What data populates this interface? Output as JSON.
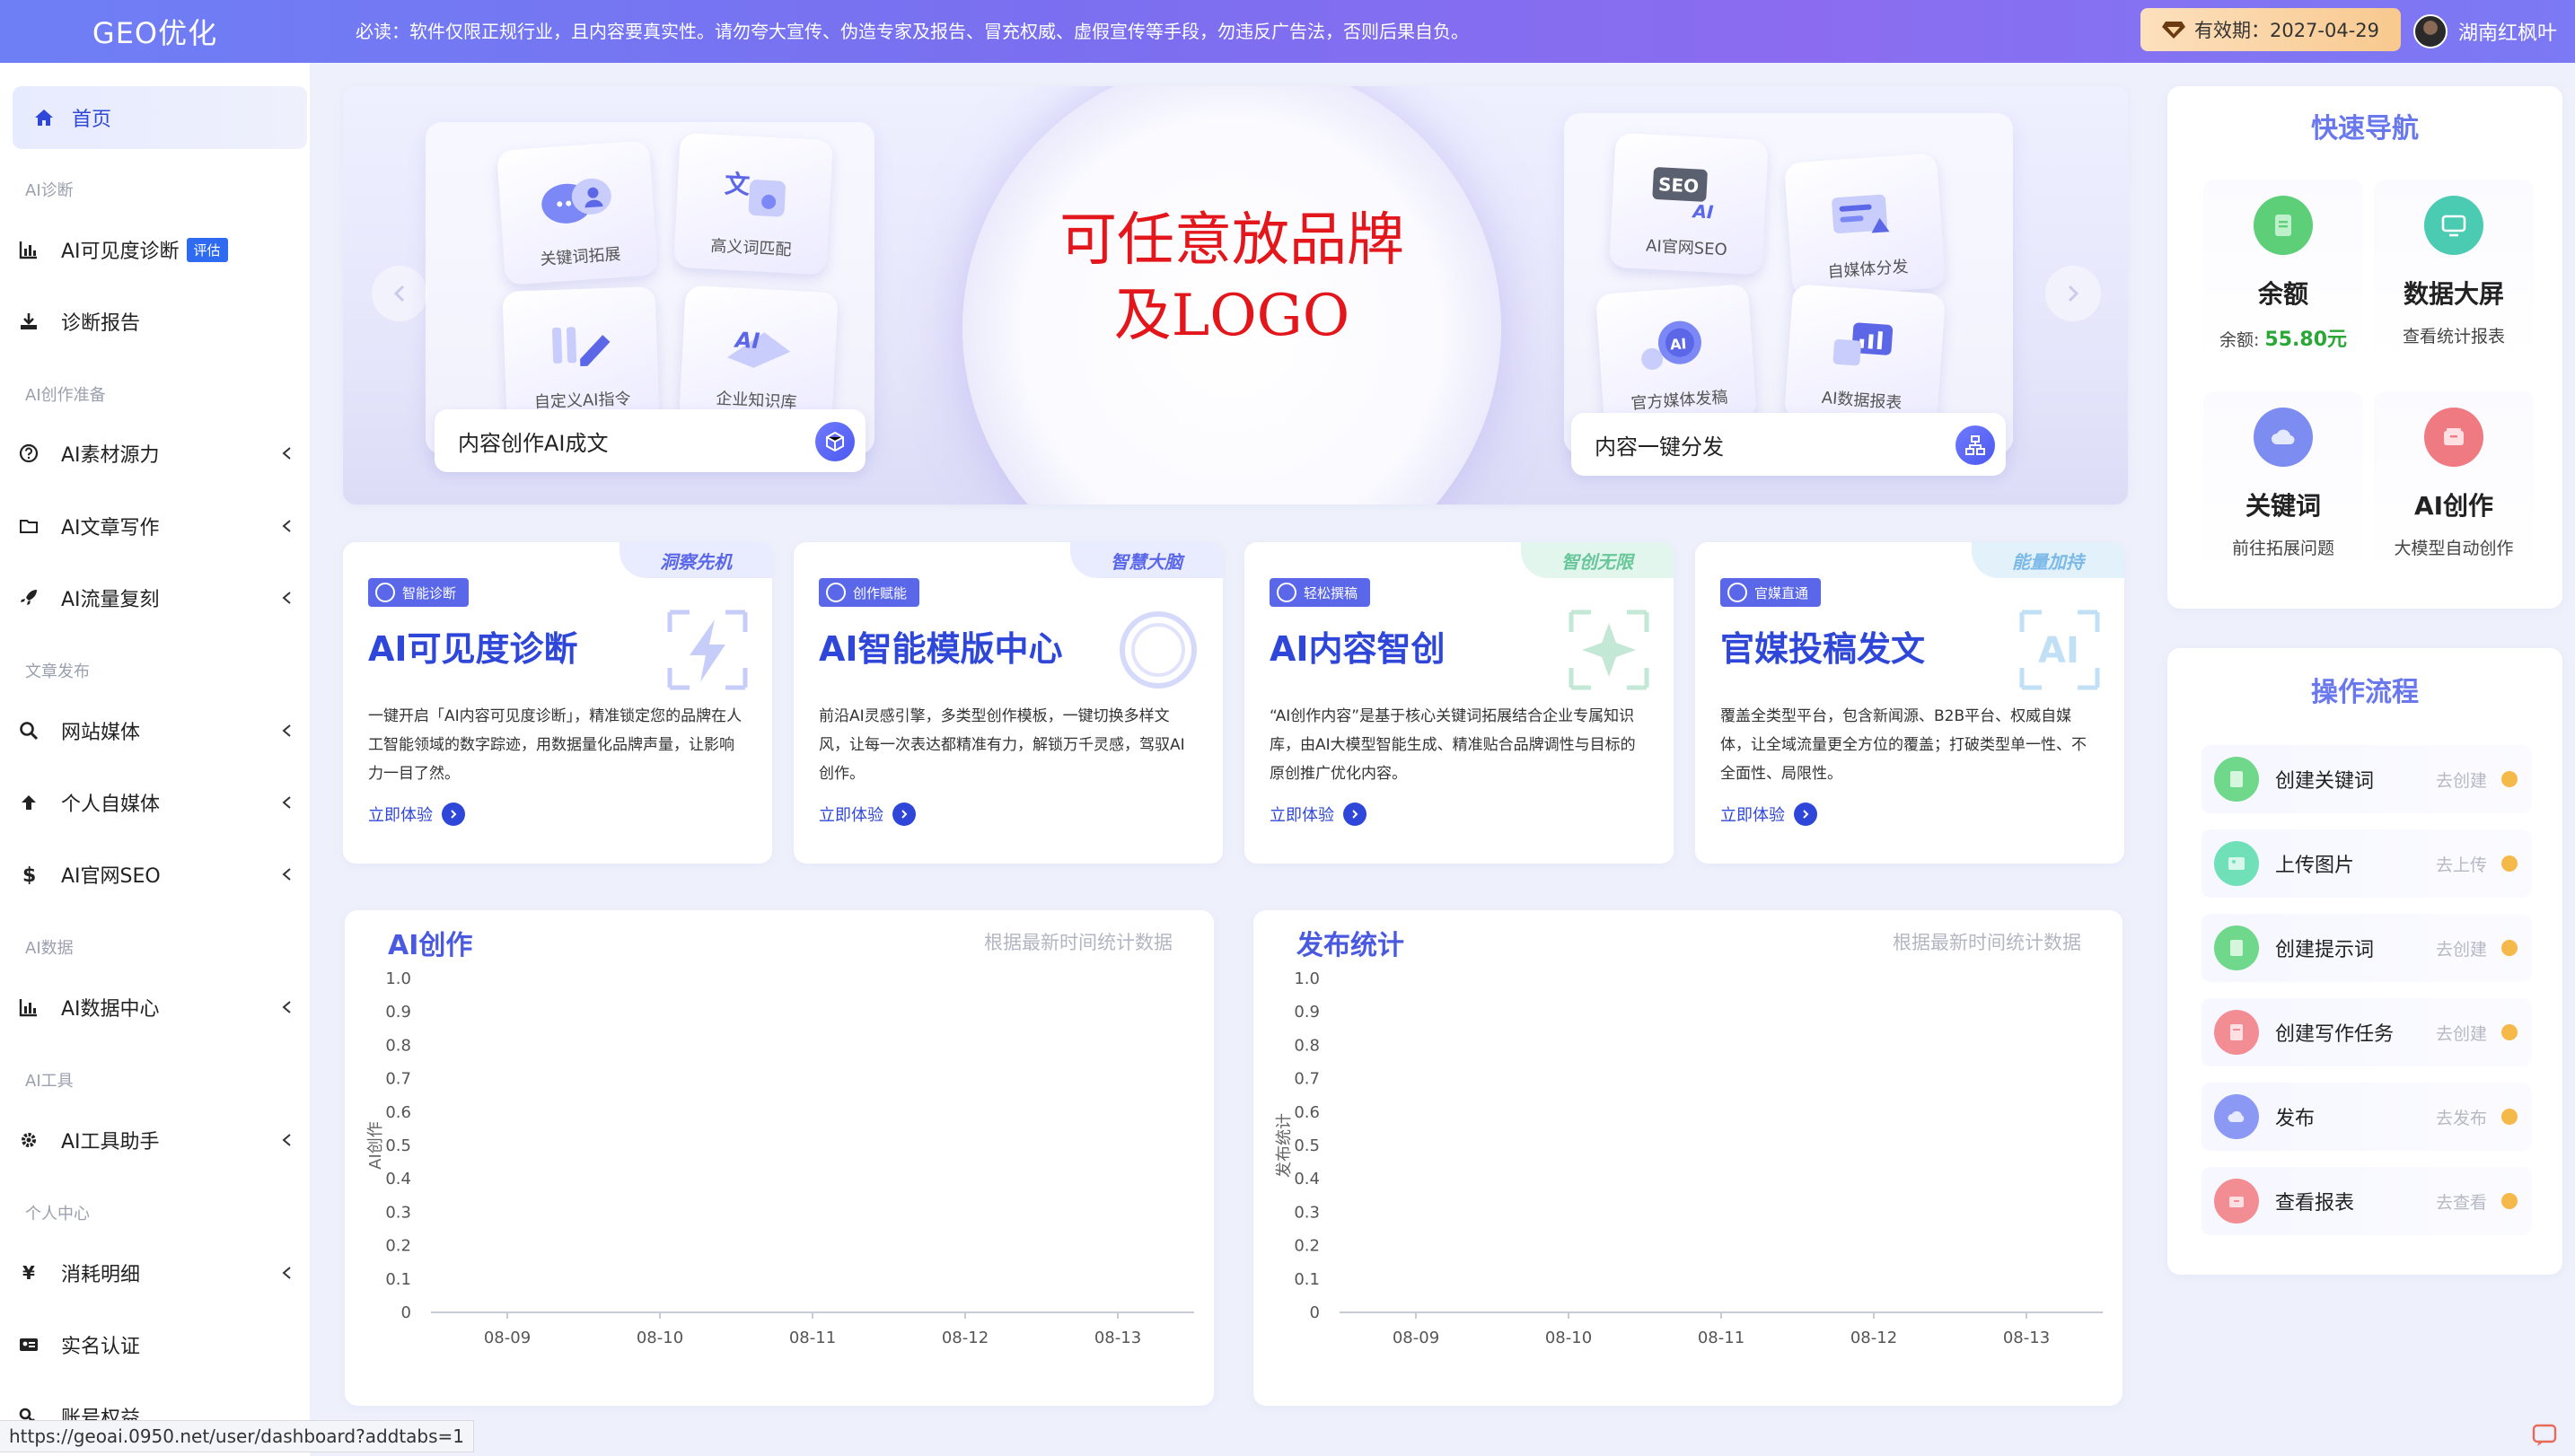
{
  "header": {
    "brand": "GEO优化",
    "notice": "必读：软件仅限正规行业，且内容要真实性。请勿夸大宣传、伪造专家及报告、冒充权威、虚假宣传等手段，勿违反广告法，否则后果自负。",
    "validity": "有效期：2027-04-29",
    "user_name": "湖南红枫叶"
  },
  "sidebar": {
    "home": "首页",
    "sections": [
      {
        "title": "AI诊断",
        "items": [
          {
            "label": "AI可见度诊断",
            "badge": "评估",
            "icon": "chart-icon"
          },
          {
            "label": "诊断报告",
            "icon": "download-icon"
          }
        ]
      },
      {
        "title": "AI创作准备",
        "items": [
          {
            "label": "AI素材源力",
            "icon": "question-icon"
          },
          {
            "label": "AI文章写作",
            "icon": "folder-icon"
          },
          {
            "label": "AI流量复刻",
            "icon": "rocket-icon"
          }
        ]
      },
      {
        "title": "文章发布",
        "items": [
          {
            "label": "网站媒体",
            "icon": "search-icon"
          },
          {
            "label": "个人自媒体",
            "icon": "arrow-up-icon"
          },
          {
            "label": "AI官网SEO",
            "icon": "dollar-icon"
          }
        ]
      },
      {
        "title": "AI数据",
        "items": [
          {
            "label": "AI数据中心",
            "icon": "chart-icon"
          }
        ]
      },
      {
        "title": "AI工具",
        "items": [
          {
            "label": "AI工具助手",
            "icon": "gear-icon"
          }
        ]
      },
      {
        "title": "个人中心",
        "items": [
          {
            "label": "消耗明细",
            "icon": "yen-icon"
          },
          {
            "label": "实名认证",
            "icon": "idcard-icon"
          },
          {
            "label": "账号权益",
            "icon": "key-icon"
          }
        ]
      }
    ]
  },
  "hero": {
    "slogan_line1": "可任意放品牌",
    "slogan_line2": "及LOGO",
    "left_cards": [
      "关键词拓展",
      "高义词匹配",
      "自定义AI指令",
      "企业知识库"
    ],
    "left_bar": "内容创作AI成文",
    "right_cards": [
      "AI官网SEO",
      "自媒体分发",
      "官方媒体发稿",
      "AI数据报表"
    ],
    "right_bar": "内容一键分发",
    "card_art": {
      "seo": "SEO",
      "ai": "AI"
    }
  },
  "features": [
    {
      "tag": "智能诊断",
      "corner": "洞察先机",
      "title": "AI可见度诊断",
      "desc": "一键开启「AI内容可见度诊断」，精准锁定您的品牌在人工智能领域的数字踪迹，用数据量化品牌声量，让影响力一目了然。",
      "link": "立即体验",
      "color": "#5a67e8",
      "cornerBg": "#e9ecff"
    },
    {
      "tag": "创作赋能",
      "corner": "智慧大脑",
      "title": "AI智能模版中心",
      "desc": "前沿AI灵感引擎，多类型创作模板，一键切换多样文风，让每一次表达都精准有力，解锁万千灵感，驾驭AI创作。",
      "link": "立即体验",
      "color": "#5a67e8",
      "cornerBg": "#e9ecff"
    },
    {
      "tag": "轻松撰稿",
      "corner": "智创无限",
      "title": "AI内容智创",
      "desc": "“AI创作内容”是基于核心关键词拓展结合企业专属知识库，由AI大模型智能生成、精准贴合品牌调性与目标的原创推广优化内容。",
      "link": "立即体验",
      "color": "#5a67e8",
      "cornerBg": "#e3f6ee"
    },
    {
      "tag": "官媒直通",
      "corner": "能量加持",
      "title": "官媒投稿发文",
      "desc": "覆盖全类型平台，包含新闻源、B2B平台、权威自媒体，让全域流量更全方位的覆盖；打破类型单一性、不全面性、局限性。",
      "link": "立即体验",
      "color": "#5a67e8",
      "cornerBg": "#e3f1fb"
    }
  ],
  "charts": [
    {
      "title": "AI创作",
      "subtitle": "根据最新时间统计数据"
    },
    {
      "title": "发布统计",
      "subtitle": "根据最新时间统计数据"
    }
  ],
  "chart_data": [
    {
      "type": "line",
      "title": "AI创作",
      "ylabel": "AI创作",
      "xlabel": "",
      "categories": [
        "08-09",
        "08-10",
        "08-11",
        "08-12",
        "08-13"
      ],
      "yticks": [
        "0",
        "0.1",
        "0.2",
        "0.3",
        "0.4",
        "0.5",
        "0.6",
        "0.7",
        "0.8",
        "0.9",
        "1.0"
      ],
      "ylim": [
        0,
        1
      ],
      "series": [],
      "grid": false
    },
    {
      "type": "line",
      "title": "发布统计",
      "ylabel": "发布统计",
      "xlabel": "",
      "categories": [
        "08-09",
        "08-10",
        "08-11",
        "08-12",
        "08-13"
      ],
      "yticks": [
        "0",
        "0.1",
        "0.2",
        "0.3",
        "0.4",
        "0.5",
        "0.6",
        "0.7",
        "0.8",
        "0.9",
        "1.0"
      ],
      "ylim": [
        0,
        1
      ],
      "series": [],
      "grid": false
    }
  ],
  "quick_nav": {
    "title": "快速导航",
    "items": [
      {
        "label": "余额",
        "sub_prefix": "余额: ",
        "sub_value": "55.80元",
        "icon": "document-icon",
        "color": "#5ccf78"
      },
      {
        "label": "数据大屏",
        "sub": "查看统计报表",
        "icon": "monitor-icon",
        "color": "#4ccbb3"
      },
      {
        "label": "关键词",
        "sub": "前往拓展问题",
        "icon": "cloud-icon",
        "color": "#7d8cf0"
      },
      {
        "label": "AI创作",
        "sub": "大模型自动创作",
        "icon": "wallet-icon",
        "color": "#f07a82"
      }
    ]
  },
  "flow": {
    "title": "操作流程",
    "items": [
      {
        "name": "创建关键词",
        "action": "去创建",
        "icon": "document-icon",
        "color": "#6fd88a"
      },
      {
        "name": "上传图片",
        "action": "去上传",
        "icon": "image-icon",
        "color": "#6fe0b8"
      },
      {
        "name": "创建提示词",
        "action": "去创建",
        "icon": "document-icon",
        "color": "#6fd88a"
      },
      {
        "name": "创建写作任务",
        "action": "去创建",
        "icon": "task-icon",
        "color": "#f38d94"
      },
      {
        "name": "发布",
        "action": "去发布",
        "icon": "cloud-icon",
        "color": "#8b98f4"
      },
      {
        "name": "查看报表",
        "action": "去查看",
        "icon": "wallet-icon",
        "color": "#f38d94"
      }
    ]
  },
  "status_url": "https://geoai.0950.net/user/dashboard?addtabs=1"
}
